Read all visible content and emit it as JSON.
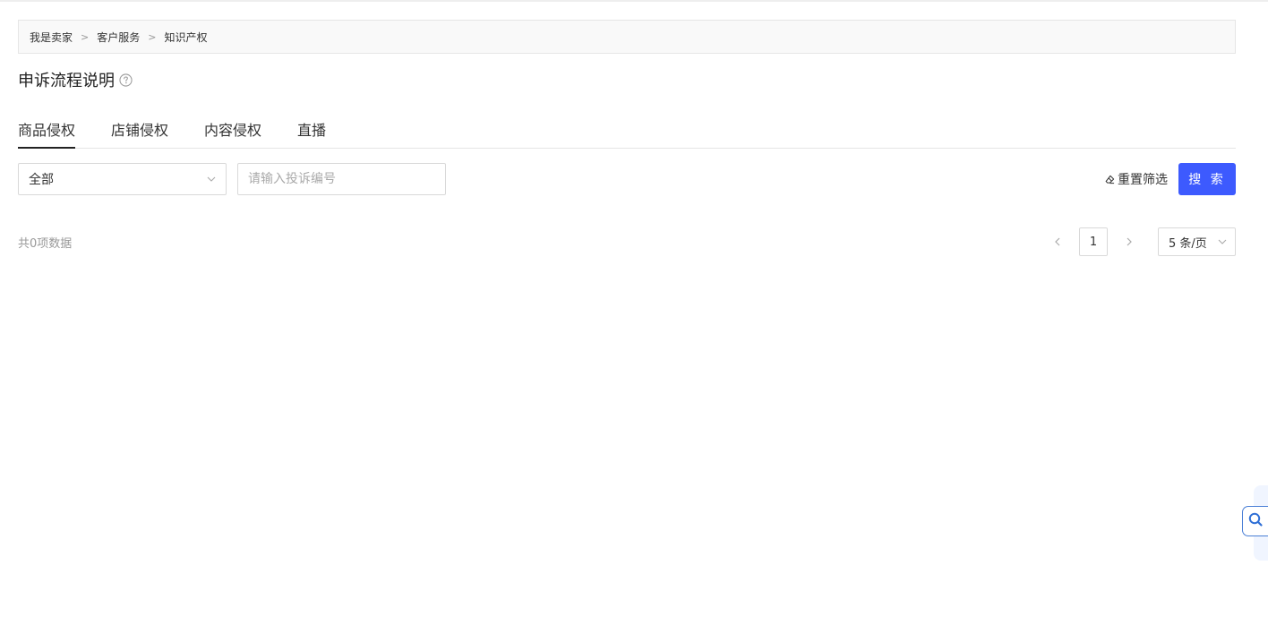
{
  "breadcrumb": {
    "items": [
      "我是卖家",
      "客户服务",
      "知识产权"
    ],
    "separator": ">"
  },
  "page_title": "申诉流程说明",
  "tabs": [
    {
      "label": "商品侵权",
      "active": true
    },
    {
      "label": "店铺侵权",
      "active": false
    },
    {
      "label": "内容侵权",
      "active": false
    },
    {
      "label": "直播",
      "active": false
    }
  ],
  "filters": {
    "select_value": "全部",
    "search_placeholder": "请输入投诉编号",
    "search_value": "",
    "reset_label": "重置筛选",
    "search_button": "搜 索"
  },
  "list": {
    "total_text": "共0项数据"
  },
  "pagination": {
    "current_page": "1",
    "page_size": "5 条/页"
  },
  "colors": {
    "primary": "#3d5afe",
    "float_accent": "#4a7fd6"
  },
  "icons": {
    "help": "help-circle-icon",
    "select_chevron": "chevron-down-icon",
    "reset": "eraser-icon",
    "prev": "chevron-left-icon",
    "next": "chevron-right-icon",
    "float": "search-icon"
  }
}
